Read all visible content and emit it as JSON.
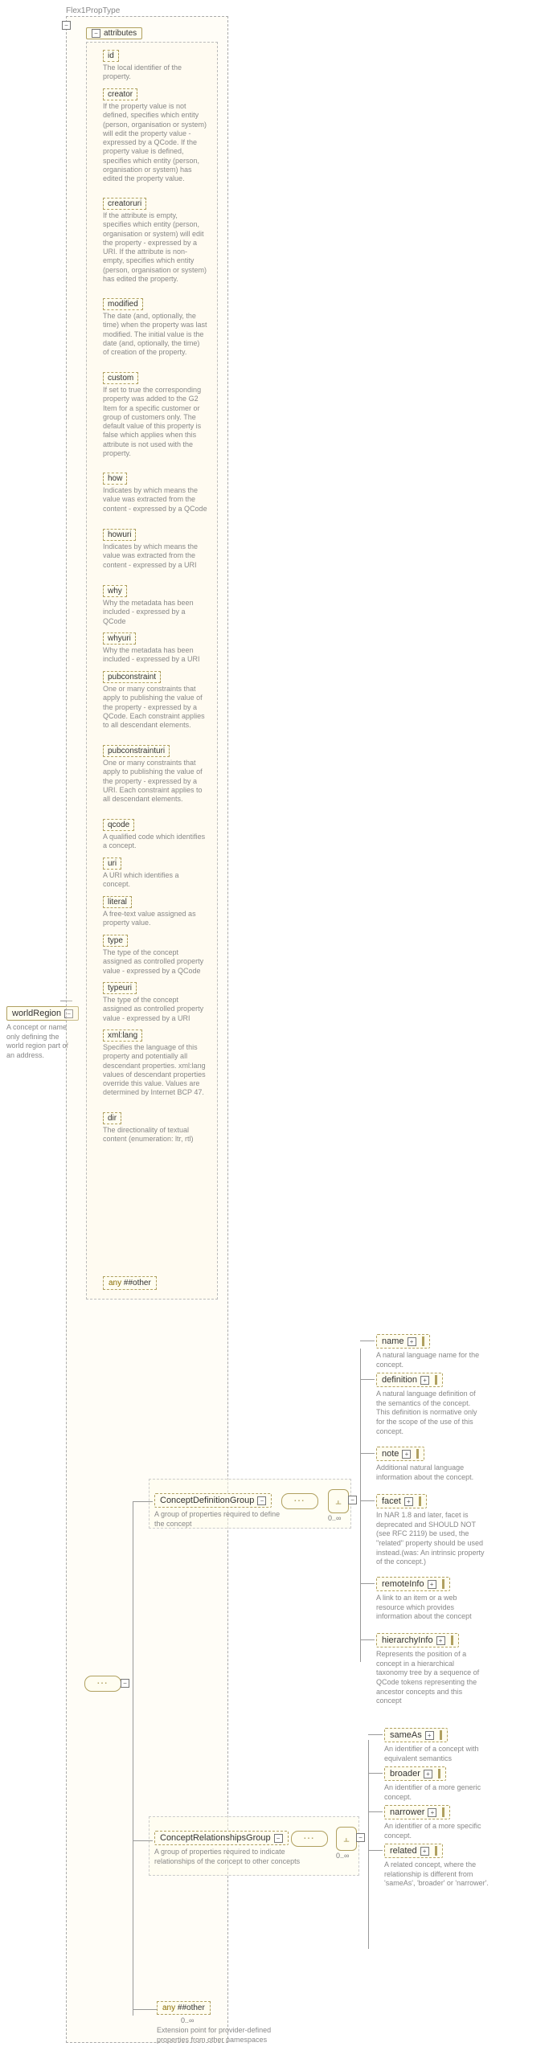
{
  "typeLabel": "Flex1PropType",
  "root": {
    "name": "worldRegion",
    "desc": "A concept or name only defining the world region part of an address."
  },
  "attrHeader": "attributes",
  "attrs": [
    {
      "name": "id",
      "desc": "The local identifier of the property."
    },
    {
      "name": "creator",
      "desc": "If the property value is not defined, specifies which entity (person, organisation or system) will edit the property value - expressed by a QCode. If the property value is defined, specifies which entity (person, organisation or system) has edited the property value."
    },
    {
      "name": "creatoruri",
      "desc": "If the attribute is empty, specifies which entity (person, organisation or system) will edit the property - expressed by a URI. If the attribute is non-empty, specifies which entity (person, organisation or system) has edited the property."
    },
    {
      "name": "modified",
      "desc": "The date (and, optionally, the time) when the property was last modified. The initial value is the date (and, optionally, the time) of creation of the property."
    },
    {
      "name": "custom",
      "desc": "If set to true the corresponding property was added to the G2 Item for a specific customer or group of customers only. The default value of this property is false which applies when this attribute is not used with the property."
    },
    {
      "name": "how",
      "desc": "Indicates by which means the value was extracted from the content - expressed by a QCode"
    },
    {
      "name": "howuri",
      "desc": "Indicates by which means the value was extracted from the content - expressed by a URI"
    },
    {
      "name": "why",
      "desc": "Why the metadata has been included - expressed by a QCode"
    },
    {
      "name": "whyuri",
      "desc": "Why the metadata has been included - expressed by a URI"
    },
    {
      "name": "pubconstraint",
      "desc": "One or many constraints that apply to publishing the value of the property - expressed by a QCode. Each constraint applies to all descendant elements."
    },
    {
      "name": "pubconstrainturi",
      "desc": "One or many constraints that apply to publishing the value of the property - expressed by a URI. Each constraint applies to all descendant elements."
    },
    {
      "name": "qcode",
      "desc": "A qualified code which identifies a concept."
    },
    {
      "name": "uri",
      "desc": "A URI which identifies a concept."
    },
    {
      "name": "literal",
      "desc": "A free-text value assigned as property value."
    },
    {
      "name": "type",
      "desc": "The type of the concept assigned as controlled property value - expressed by a QCode"
    },
    {
      "name": "typeuri",
      "desc": "The type of the concept assigned as controlled property value - expressed by a URI"
    },
    {
      "name": "xml:lang",
      "desc": "Specifies the language of this property and potentially all descendant properties. xml:lang values of descendant properties override this value. Values are determined by Internet BCP 47."
    },
    {
      "name": "dir",
      "desc": "The directionality of textual content (enumeration: ltr, rtl)"
    }
  ],
  "anyAttr": {
    "prefix": "any",
    "ns": "##other"
  },
  "cdg": {
    "label": "ConceptDefinitionGroup",
    "desc": "A group of properties required to define the concept",
    "card": "0..∞",
    "children": [
      {
        "name": "name",
        "desc": "A natural language name for the concept."
      },
      {
        "name": "definition",
        "desc": "A natural language definition of the semantics of the concept. This definition is normative only for the scope of the use of this concept."
      },
      {
        "name": "note",
        "desc": "Additional natural language information about the concept."
      },
      {
        "name": "facet",
        "desc": "In NAR 1.8 and later, facet is deprecated and SHOULD NOT (see RFC 2119) be used, the \"related\" property should be used instead.(was: An intrinsic property of the concept.)"
      },
      {
        "name": "remoteInfo",
        "desc": "A link to an item or a web resource which provides information about the concept"
      },
      {
        "name": "hierarchyInfo",
        "desc": "Represents the position of a concept in a hierarchical taxonomy tree by a sequence of QCode tokens representing the ancestor concepts and this concept"
      }
    ]
  },
  "crg": {
    "label": "ConceptRelationshipsGroup",
    "desc": "A group of properties required to indicate relationships of the concept to other concepts",
    "card": "0..∞",
    "children": [
      {
        "name": "sameAs",
        "desc": "An identifier of a concept with equivalent semantics"
      },
      {
        "name": "broader",
        "desc": "An identifier of a more generic concept."
      },
      {
        "name": "narrower",
        "desc": "An identifier of a more specific concept."
      },
      {
        "name": "related",
        "desc": "A related concept, where the relationship is different from 'sameAs', 'broader' or 'narrower'."
      }
    ]
  },
  "anyElem": {
    "prefix": "any",
    "ns": "##other",
    "card": "0..∞",
    "desc": "Extension point for provider-defined properties from other namespaces"
  }
}
